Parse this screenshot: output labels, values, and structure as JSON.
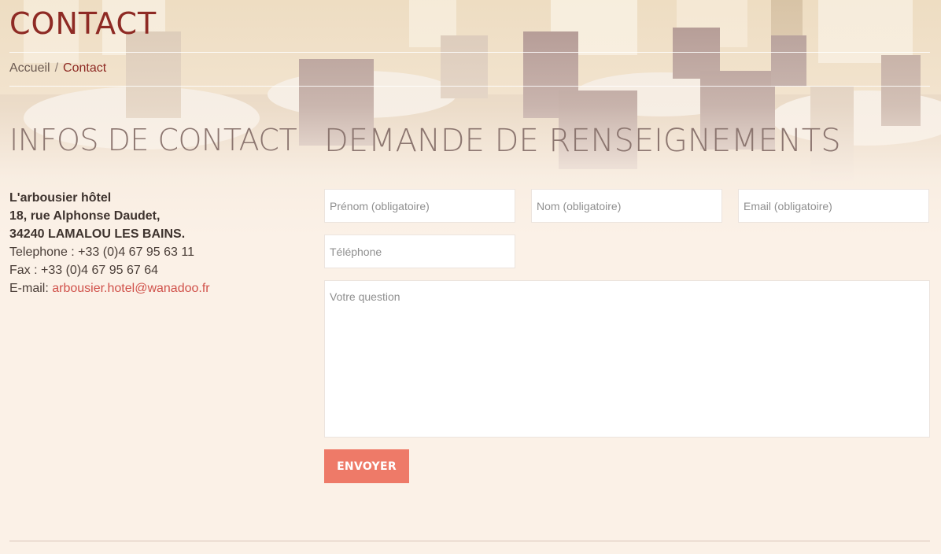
{
  "header": {
    "title": "CONTACT",
    "breadcrumb": {
      "home": "Accueil",
      "separator": "/",
      "current": "Contact"
    }
  },
  "contact_info": {
    "title": "INFOS DE CONTACT",
    "name": "L'arbousier hôtel",
    "street": "18, rue Alphonse Daudet,",
    "city": "34240 LAMALOU LES BAINS.",
    "telephone": "Telephone : +33 (0)4 67 95 63 11",
    "fax": "Fax : +33 (0)4 67 95 67 64",
    "email_label": "E-mail: ",
    "email": "arbousier.hotel@wanadoo.fr"
  },
  "form": {
    "title": "DEMANDE DE RENSEIGNEMENTS",
    "prenom_placeholder": "Prénom (obligatoire)",
    "nom_placeholder": "Nom (obligatoire)",
    "email_placeholder": "Email (obligatoire)",
    "telephone_placeholder": "Téléphone",
    "question_placeholder": "Votre question",
    "submit_label": "ENVOYER"
  },
  "colors": {
    "accent": "#8e2a24",
    "link": "#d0514a",
    "button": "#ee7a68",
    "page_background": "#fbf1e7"
  }
}
